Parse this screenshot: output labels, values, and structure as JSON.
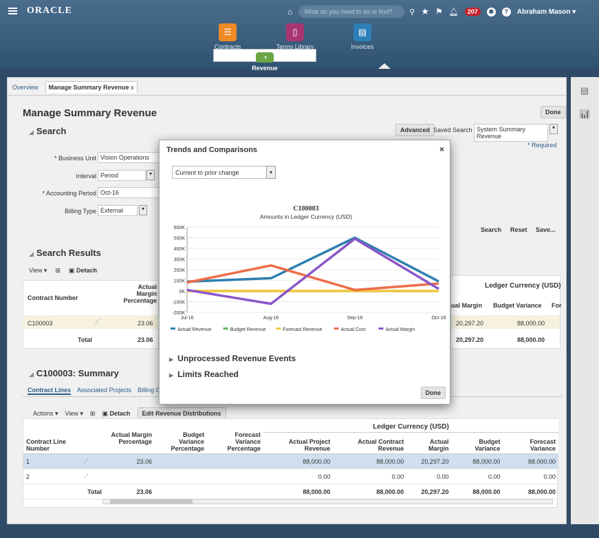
{
  "header": {
    "logo": "ORACLE",
    "search_placeholder": "What do you need to do or find?",
    "notifications": "207",
    "user": "Abraham Mason ▾"
  },
  "nav": [
    {
      "label": "Contracts",
      "icon": "contracts-icon",
      "color": "#f08a24"
    },
    {
      "label": "Terms Library",
      "icon": "terms-library-icon",
      "color": "#a8356f"
    },
    {
      "label": "Invoices",
      "icon": "invoices-icon",
      "color": "#2c7fb8"
    },
    {
      "label": "Revenue",
      "icon": "revenue-icon",
      "color": "#6aa443"
    }
  ],
  "tabs": {
    "overview": "Overview",
    "current": "Manage Summary Revenue",
    "close": "x"
  },
  "page": {
    "title": "Manage Summary Revenue",
    "done": "Done"
  },
  "search": {
    "title": "Search",
    "advanced": "Advanced",
    "saved_search_label": "Saved Search",
    "saved_search_value": "System Summary Revenue",
    "required": "* Required",
    "fields": [
      {
        "label": "* Business Unit",
        "value": "Vision Operations"
      },
      {
        "label": "Interval",
        "value": "Period"
      },
      {
        "label": "* Accounting Period",
        "value": "Oct-16"
      },
      {
        "label": "Billing Type",
        "value": "External"
      }
    ],
    "buttons": {
      "search": "Search",
      "reset": "Reset",
      "save": "Save..."
    }
  },
  "results": {
    "title": "Search Results",
    "view": "View ▾",
    "detach": "Detach",
    "col_contract": "Contract Number",
    "col_margin_pct": "Actual Margin Percentage",
    "ledger_header": "Ledger Currency (USD)",
    "col_actual_margin": "ual Margin",
    "col_budget_var": "Budget Variance",
    "col_for": "For",
    "row": {
      "contract": "C100003",
      "pct": "23.06",
      "margin": "20,297.20",
      "budget": "88,000.00"
    },
    "total": {
      "label": "Total",
      "pct": "23.06",
      "margin": "20,297.20",
      "budget": "88,000.00"
    }
  },
  "summary": {
    "title": "C100003: Summary",
    "tabs": [
      "Contract Lines",
      "Associated Projects",
      "Billing Co"
    ],
    "actions": "Actions ▾",
    "view": "View ▾",
    "detach": "Detach",
    "edit": "Edit Revenue Distributions",
    "ledger_header": "Ledger Currency (USD)",
    "cols": [
      "Contract Line Number",
      "Actual Margin Percentage",
      "Budget Variance Percentage",
      "Forecast Variance Percentage",
      "Actual Project Revenue",
      "Actual Contract Revenue",
      "Actual Margin",
      "Budget Variance",
      "Forecast Variance"
    ],
    "rows": [
      {
        "line": "1",
        "pct": "23.06",
        "apr": "88,000.00",
        "acr": "88,000.00",
        "am": "20,297.20",
        "bv": "88,000.00",
        "fv": "88,000.00"
      },
      {
        "line": "2",
        "pct": "",
        "apr": "0.00",
        "acr": "0.00",
        "am": "0.00",
        "bv": "0.00",
        "fv": "0.00"
      }
    ],
    "total": {
      "label": "Total",
      "pct": "23.06",
      "apr": "88,000.00",
      "acr": "88,000.00",
      "am": "20,297.20",
      "bv": "88,000.00",
      "fv": "88,000.00"
    }
  },
  "modal": {
    "title": "Trends and Comparisons",
    "close": "×",
    "dropdown": "Current to prior change",
    "unprocessed": "Unprocessed Revenue Events",
    "limits": "Limits Reached",
    "done": "Done"
  },
  "chart_data": {
    "type": "line",
    "title": "C100003",
    "subtitle": "Amounts in Ledger Currency (USD)",
    "categories": [
      "Jul-16",
      "Aug-16",
      "Sep-16",
      "Oct-16"
    ],
    "ylim": [
      -200000,
      600000
    ],
    "yticks": [
      "600K",
      "500K",
      "400K",
      "300K",
      "200K",
      "100K",
      "0K",
      "-100K",
      "-200K"
    ],
    "series": [
      {
        "name": "Actual Revenue",
        "color": "#2f7fb0",
        "values": [
          88000,
          120000,
          500000,
          90000
        ]
      },
      {
        "name": "Budget Revenue",
        "color": "#5cb85c",
        "values": [
          0,
          0,
          0,
          0
        ]
      },
      {
        "name": "Forecast Revenue",
        "color": "#f5c842",
        "values": [
          0,
          0,
          0,
          0
        ]
      },
      {
        "name": "Actual Cost",
        "color": "#ee6c47",
        "values": [
          80000,
          240000,
          10000,
          70000
        ]
      },
      {
        "name": "Actual Margin",
        "color": "#8a56c8",
        "values": [
          10000,
          -120000,
          490000,
          20000
        ]
      }
    ]
  }
}
